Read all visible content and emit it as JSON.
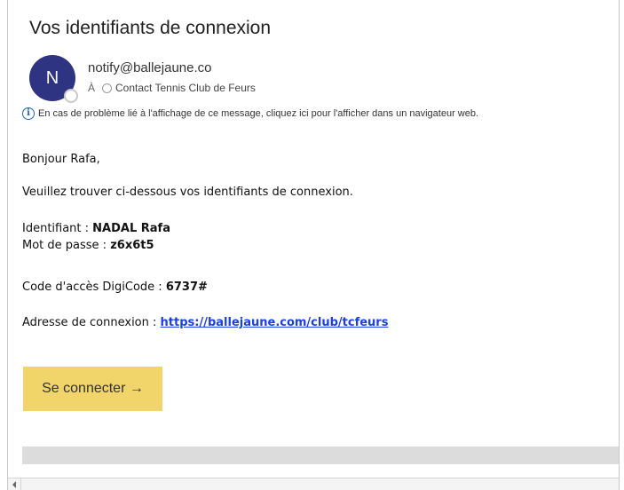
{
  "email": {
    "subject": "Vos identifiants de connexion",
    "avatar_initial": "N",
    "sender": "notify@ballejaune.co",
    "to_prefix": "À",
    "recipient": "Contact Tennis Club de Feurs",
    "info_icon_glyph": "i",
    "info_text": "En cas de problème lié à l'affichage de ce message, cliquez ici pour l'afficher dans un navigateur web.",
    "greeting": "Bonjour Rafa,",
    "intro": "Veuillez trouver ci-dessous vos identifiants de connexion.",
    "ident_label": "Identifiant : ",
    "ident_value": "NADAL Rafa",
    "password_label": "Mot de passe : ",
    "password_value": "z6x6t5",
    "code_label": "Code d'accès DigiCode : ",
    "code_value": "6737#",
    "address_label": "Adresse de connexion : ",
    "address_link": "https://ballejaune.com/club/tcfeurs",
    "connect_button": "Se connecter →"
  },
  "colors": {
    "avatar": "#2e3382",
    "button": "#f1d46a",
    "link": "#1b3ee6",
    "info_icon": "#1a66c4"
  },
  "icons": {
    "info": "info-icon",
    "presence": "presence-status-icon",
    "scroll_left": "scroll-left-arrow-icon"
  }
}
